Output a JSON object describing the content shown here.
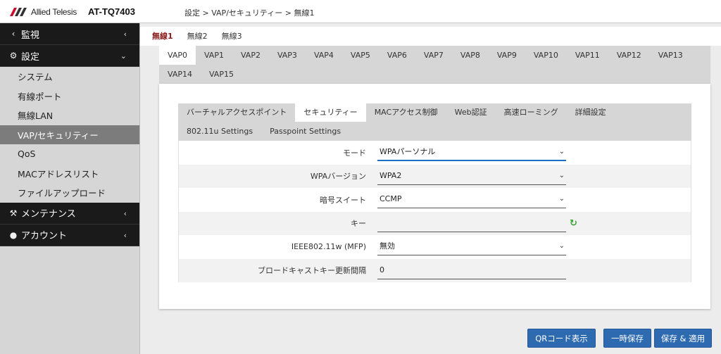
{
  "header": {
    "logo_text": "Allied Telesis",
    "model": "AT-TQ7403",
    "breadcrumb": "設定 > VAP/セキュリティー > 無線1"
  },
  "sidebar": {
    "groups": [
      {
        "label": "監視",
        "icon": "share-icon"
      },
      {
        "label": "設定",
        "icon": "gear-icon"
      }
    ],
    "items": [
      "システム",
      "有線ポート",
      "無線LAN",
      "VAP/セキュリティー",
      "QoS",
      "MACアドレスリスト",
      "ファイルアップロード"
    ],
    "active_item": "VAP/セキュリティー",
    "groups_bottom": [
      {
        "label": "メンテナンス",
        "icon": "wrench-icon"
      },
      {
        "label": "アカウント",
        "icon": "user-icon"
      }
    ]
  },
  "radio_tabs": [
    "無線1",
    "無線2",
    "無線3"
  ],
  "vap_tabs": [
    "VAP0",
    "VAP1",
    "VAP2",
    "VAP3",
    "VAP4",
    "VAP5",
    "VAP6",
    "VAP7",
    "VAP8",
    "VAP9",
    "VAP10",
    "VAP11",
    "VAP12",
    "VAP13",
    "VAP14",
    "VAP15"
  ],
  "sub_tabs": [
    "バーチャルアクセスポイント",
    "セキュリティー",
    "MACアクセス制御",
    "Web認証",
    "高速ローミング",
    "詳細設定",
    "802.11u Settings",
    "Passpoint Settings"
  ],
  "form": {
    "mode_label": "モード",
    "mode_value": "WPAパーソナル",
    "wpa_version_label": "WPAバージョン",
    "wpa_version_value": "WPA2",
    "cipher_label": "暗号スイート",
    "cipher_value": "CCMP",
    "key_label": "キー",
    "key_value": "",
    "mfp_label": "IEEE802.11w (MFP)",
    "mfp_value": "無効",
    "broadcast_label": "ブロードキャストキー更新間隔",
    "broadcast_value": "0"
  },
  "buttons": {
    "qr": "QRコード表示",
    "temp_save": "一時保存",
    "save_apply": "保存 & 適用"
  },
  "colors": {
    "accent": "#2e6ab0",
    "active_tab_text": "#8b1a1a",
    "refresh": "#3aa335"
  }
}
